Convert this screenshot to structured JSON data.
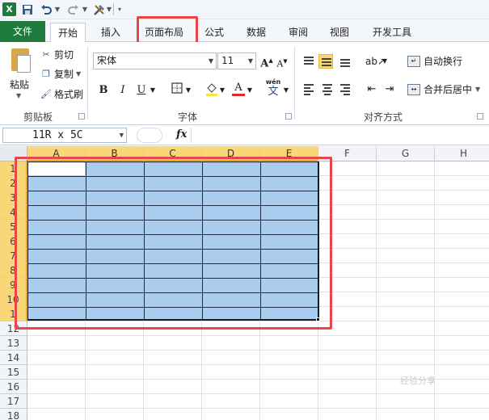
{
  "quick_access": {
    "app_logo": "X",
    "icons": [
      "excel-logo-icon",
      "save-icon",
      "undo-icon",
      "redo-icon",
      "tools-icon"
    ]
  },
  "tabs": [
    "文件",
    "开始",
    "插入",
    "页面布局",
    "公式",
    "数据",
    "审阅",
    "视图",
    "开发工具"
  ],
  "active_tab": "开始",
  "highlighted_tab": "页面布局",
  "clipboard": {
    "paste_label": "粘贴",
    "cut_label": "剪切",
    "copy_label": "复制",
    "format_painter_label": "格式刷",
    "group_label": "剪贴板"
  },
  "font": {
    "font_name": "宋体",
    "font_size": "11",
    "bold": "B",
    "italic": "I",
    "underline": "U",
    "font_color_letter": "A",
    "grow_font": "A",
    "shrink_font": "A",
    "wen": "wén",
    "wen_char": "文",
    "group_label": "字体"
  },
  "alignment": {
    "wrap_label": "自动换行",
    "merge_label": "合并后居中",
    "group_label": "对齐方式"
  },
  "formula_bar": {
    "name_box": "11R x 5C",
    "fx": "fx",
    "content": ""
  },
  "sheet": {
    "columns": [
      "A",
      "B",
      "C",
      "D",
      "E",
      "F",
      "G",
      "H"
    ],
    "rows": [
      "1",
      "2",
      "3",
      "4",
      "5",
      "6",
      "7",
      "8",
      "9",
      "10",
      "1",
      "12",
      "13",
      "14",
      "15",
      "16",
      "17",
      "18"
    ],
    "selected_columns": 5,
    "selected_rows": 11
  },
  "watermark": "经验分享"
}
